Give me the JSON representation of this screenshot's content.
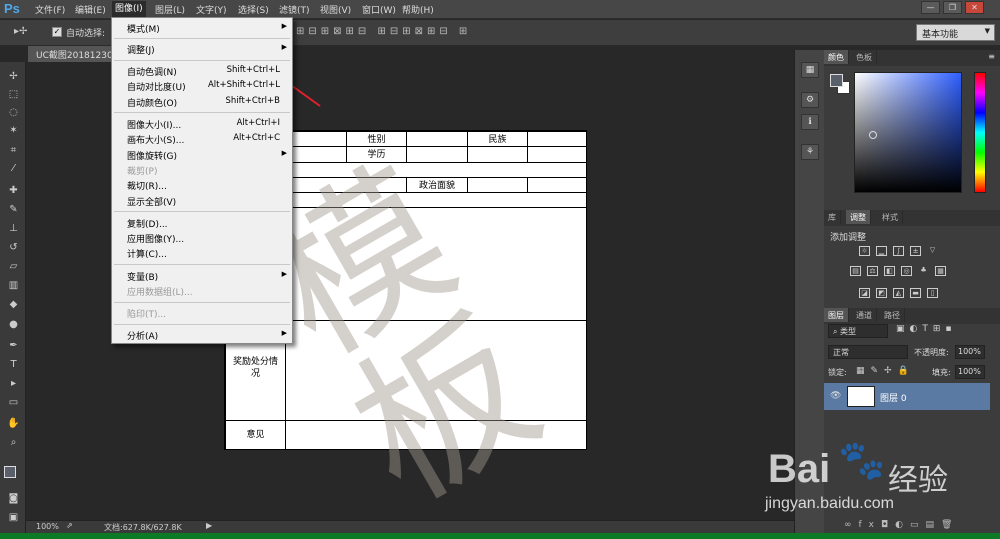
{
  "app": {
    "logo": "Ps"
  },
  "menubar": {
    "items": [
      "文件(F)",
      "编辑(E)",
      "图像(I)",
      "图层(L)",
      "文字(Y)",
      "选择(S)",
      "滤镜(T)",
      "视图(V)",
      "窗口(W)",
      "帮助(H)"
    ]
  },
  "window_controls": {
    "minimize": "—",
    "restore": "❐",
    "close": "✕"
  },
  "options_bar": {
    "auto_select_label": "自动选择:",
    "workspace": "基本功能"
  },
  "document": {
    "tab_title": "UC截图20181230"
  },
  "image_menu": {
    "items": [
      {
        "label": "模式(M)",
        "shortcut": "",
        "submenu": true,
        "disabled": false
      },
      {
        "label": "调整(J)",
        "shortcut": "",
        "submenu": true,
        "disabled": false
      },
      {
        "label": "自动色调(N)",
        "shortcut": "Shift+Ctrl+L",
        "submenu": false,
        "disabled": false
      },
      {
        "label": "自动对比度(U)",
        "shortcut": "Alt+Shift+Ctrl+L",
        "submenu": false,
        "disabled": false
      },
      {
        "label": "自动颜色(O)",
        "shortcut": "Shift+Ctrl+B",
        "submenu": false,
        "disabled": false
      },
      {
        "label": "图像大小(I)...",
        "shortcut": "Alt+Ctrl+I",
        "submenu": false,
        "disabled": false
      },
      {
        "label": "画布大小(S)...",
        "shortcut": "Alt+Ctrl+C",
        "submenu": false,
        "disabled": false
      },
      {
        "label": "图像旋转(G)",
        "shortcut": "",
        "submenu": true,
        "disabled": false
      },
      {
        "label": "裁剪(P)",
        "shortcut": "",
        "submenu": false,
        "disabled": true
      },
      {
        "label": "裁切(R)...",
        "shortcut": "",
        "submenu": false,
        "disabled": false
      },
      {
        "label": "显示全部(V)",
        "shortcut": "",
        "submenu": false,
        "disabled": false
      },
      {
        "label": "复制(D)...",
        "shortcut": "",
        "submenu": false,
        "disabled": false
      },
      {
        "label": "应用图像(Y)...",
        "shortcut": "",
        "submenu": false,
        "disabled": false
      },
      {
        "label": "计算(C)...",
        "shortcut": "",
        "submenu": false,
        "disabled": false
      },
      {
        "label": "变量(B)",
        "shortcut": "",
        "submenu": true,
        "disabled": false
      },
      {
        "label": "应用数据组(L)...",
        "shortcut": "",
        "submenu": false,
        "disabled": true
      },
      {
        "label": "陷印(T)...",
        "shortcut": "",
        "submenu": false,
        "disabled": true
      },
      {
        "label": "分析(A)",
        "shortcut": "",
        "submenu": true,
        "disabled": false
      }
    ]
  },
  "doc_content": {
    "gender": "性别",
    "ethnicity": "民族",
    "education": "学历",
    "political_status": "政治面貌",
    "rewards": "奖励处分情况",
    "opinion": "意见",
    "watermark": "模板"
  },
  "status_bar": {
    "zoom": "100%",
    "doc_size": "文档:627.8K/627.8K"
  },
  "color_panel": {
    "tabs": [
      "颜色",
      "色板"
    ]
  },
  "adjust_panel": {
    "tabs": [
      "库",
      "调整",
      "样式"
    ],
    "title": "添加调整"
  },
  "layers_panel": {
    "tabs": [
      "图层",
      "通道",
      "路径"
    ],
    "filter_type": "类型",
    "blend_mode": "正常",
    "opacity_label": "不透明度:",
    "opacity_value": "100%",
    "lock_label": "锁定:",
    "fill_label": "填充:",
    "fill_value": "100%",
    "layer_name": "图层 0"
  },
  "baidu": {
    "brand": "Bai",
    "brand_suffix": "经验",
    "url": "jingyan.baidu.com"
  },
  "colors": {
    "accent_arrow": "#e0202a",
    "ps_blue": "#4fa8e8",
    "layer_selected": "#5a7aa3"
  }
}
